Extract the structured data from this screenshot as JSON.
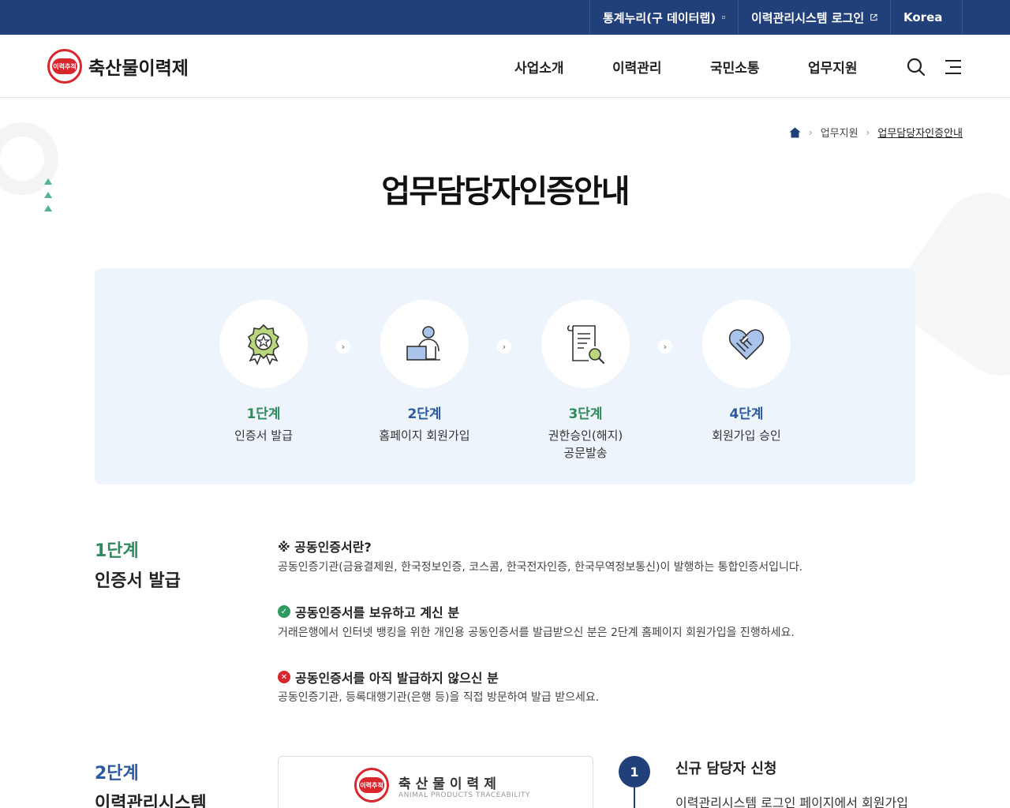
{
  "topbar": {
    "links": [
      {
        "label": "통계누리(구 데이터랩)"
      },
      {
        "label": "이력관리시스템 로그인"
      }
    ],
    "language": "Korea"
  },
  "header": {
    "logo_text": "축산물이력제",
    "logo_mark_text": "이력추적",
    "nav": [
      "사업소개",
      "이력관리",
      "국민소통",
      "업무지원"
    ]
  },
  "breadcrumb": {
    "items": [
      "업무지원",
      "업무담당자인증안내"
    ]
  },
  "page_title": "업무담당자인증안내",
  "steps": [
    {
      "num": "1단계",
      "desc": "인증서 발급",
      "desc2": "",
      "color": "#2f8a5e"
    },
    {
      "num": "2단계",
      "desc": "홈페이지 회원가입",
      "desc2": "",
      "color": "#2c5aa0"
    },
    {
      "num": "3단계",
      "desc": "권한승인(해지)",
      "desc2": "공문발송",
      "color": "#2f8a5e"
    },
    {
      "num": "4단계",
      "desc": "회원가입 승인",
      "desc2": "",
      "color": "#2c5aa0"
    }
  ],
  "section1": {
    "step": "1단계",
    "title": "인증서 발급",
    "items": [
      {
        "title": "※ 공동인증서란?",
        "desc": "공동인증기관(금융결제원, 한국정보인증, 코스콤, 한국전자인증, 한국무역정보통신)이 발행하는 통합인증서입니다."
      },
      {
        "title": "공동인증서를 보유하고 계신 분",
        "desc": "거래은행에서 인터넷 뱅킹을 위한 개인용 공동인증서를 발급받으신 분은 2단계 홈페이지 회원가입을 진행하세요."
      },
      {
        "title": "공동인증서를 아직 발급하지 않으신 분",
        "desc": "공동인증기관, 등록대행기관(은행 등)을 직접 방문하여 발급 받으세요."
      }
    ]
  },
  "section2": {
    "step": "2단계",
    "title": "이력관리시스템",
    "card_title": "축산물이력제",
    "card_sub": "ANIMAL PRODUCTS TRACEABILITY",
    "timeline": [
      {
        "num": "1",
        "title": "신규 담당자 신청",
        "desc": "이력관리시스템 로그인 페이지에서 회원가입"
      }
    ]
  }
}
